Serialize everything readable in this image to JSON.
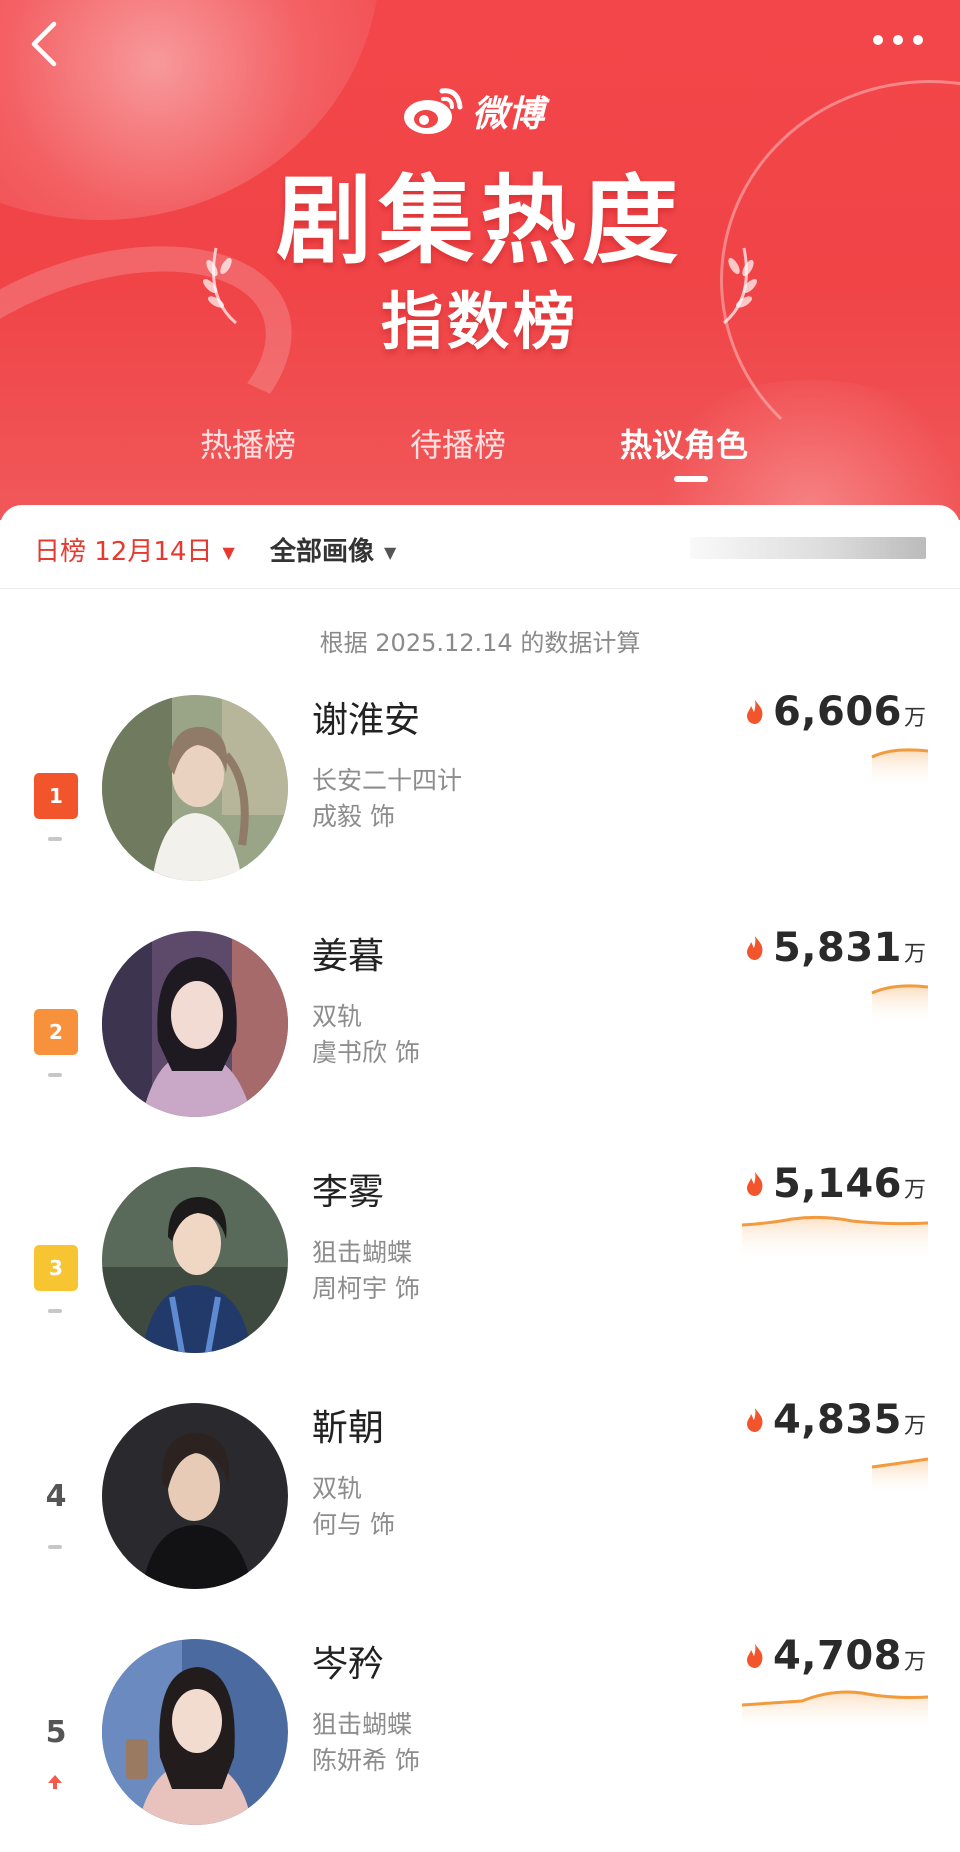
{
  "app": {
    "logo_text": "微博",
    "title_main": "剧集热度",
    "title_sub": "指数榜"
  },
  "tabs": [
    "热播榜",
    "待播榜",
    "热议角色"
  ],
  "active_tab_index": 2,
  "filters": {
    "date_label": "日榜 12月14日",
    "image_label": "全部画像"
  },
  "calc_note": "根据 2025.12.14 的数据计算",
  "unit": "万",
  "colors": {
    "brand_red": "#f04447",
    "date_red": "#e53a2f",
    "trend_orange": "#f39a3d",
    "rank1": "#f2552c",
    "rank2": "#f7913b",
    "rank3": "#f7c531"
  },
  "ranking": [
    {
      "rank": "1",
      "name": "谢淮安",
      "drama": "长安二十四计",
      "actor": "成毅 饰",
      "heat": "6,606",
      "change": "flat"
    },
    {
      "rank": "2",
      "name": "姜暮",
      "drama": "双轨",
      "actor": "虞书欣 饰",
      "heat": "5,831",
      "change": "flat"
    },
    {
      "rank": "3",
      "name": "李雾",
      "drama": "狙击蝴蝶",
      "actor": "周柯宇 饰",
      "heat": "5,146",
      "change": "flat"
    },
    {
      "rank": "4",
      "name": "靳朝",
      "drama": "双轨",
      "actor": "何与 饰",
      "heat": "4,835",
      "change": "flat"
    },
    {
      "rank": "5",
      "name": "岑矜",
      "drama": "狙击蝴蝶",
      "actor": "陈妍希 饰",
      "heat": "4,708",
      "change": "up"
    }
  ]
}
